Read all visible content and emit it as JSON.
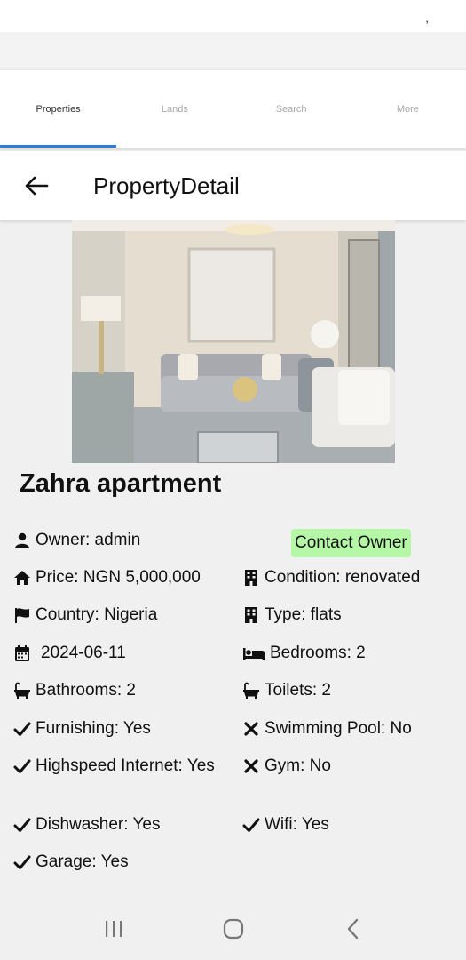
{
  "status_bar": {
    "mark": ","
  },
  "tabs": [
    {
      "label": "Properties",
      "active": true
    },
    {
      "label": "Lands",
      "active": false
    },
    {
      "label": "Search",
      "active": false
    },
    {
      "label": "More",
      "active": false
    }
  ],
  "appbar": {
    "title": "PropertyDetail",
    "back_icon": "arrow-left-icon"
  },
  "property": {
    "name": "Zahra apartment",
    "contact_label": "Contact Owner",
    "owner": "Owner: admin",
    "price": "Price: NGN 5,000,000",
    "condition": "Condition: renovated",
    "country": "Country: Nigeria",
    "type": "Type: flats",
    "date": "2024-06-11",
    "bedrooms": "Bedrooms: 2",
    "bathrooms": "Bathrooms: 2",
    "toilets": "Toilets: 2",
    "furnishing": "Furnishing: Yes",
    "swimming_pool": "Swimming Pool: No",
    "internet": "Highspeed Internet: Yes",
    "gym": "Gym: No",
    "dishwasher": "Dishwasher: Yes",
    "wifi": "Wifi: Yes",
    "garage": "Garage: Yes"
  },
  "icons": {
    "owner": "user-icon",
    "price": "home-icon",
    "condition": "building-icon",
    "country": "flag-icon",
    "type": "building-icon",
    "date": "calendar-icon",
    "bedrooms": "bed-icon",
    "bathrooms": "bath-icon",
    "toilets": "bath-icon",
    "yes": "check-icon",
    "no": "cross-icon"
  },
  "colors": {
    "accent": "#2a7de1",
    "contact_bg": "#b6f7a7"
  }
}
